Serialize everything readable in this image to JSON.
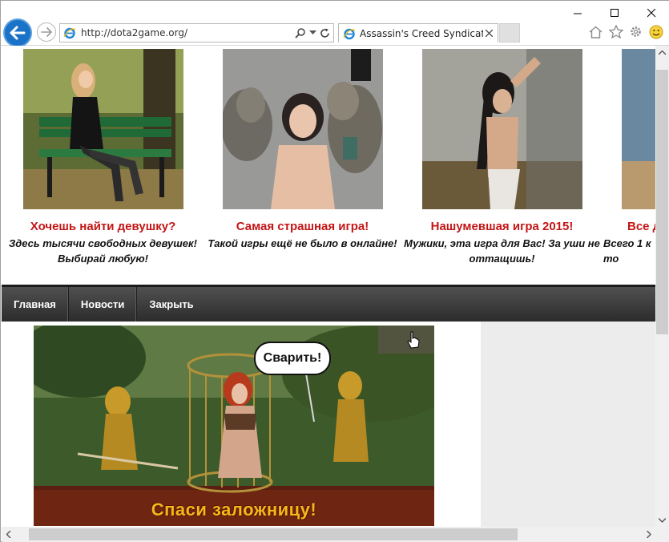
{
  "browser": {
    "url": "http://dota2game.org/",
    "tab_title": "Assassin's Creed Syndicate |...",
    "colors": {
      "back_button": "#1a73c7",
      "accent_red": "#c41616"
    },
    "icons": [
      "back-arrow-icon",
      "forward-arrow-icon",
      "ie-logo-icon",
      "search-icon",
      "dropdown-icon",
      "refresh-icon",
      "close-icon",
      "home-icon",
      "favorites-star-icon",
      "gear-icon",
      "smiley-feedback-icon",
      "minimize-icon",
      "maximize-icon",
      "window-close-icon"
    ]
  },
  "ads": [
    {
      "headline": "Хочешь найти девушку?",
      "text": "Здесь тысячи свободных девушек! Выбирай любую!"
    },
    {
      "headline": "Самая страшная игра!",
      "text": "Такой игры ещё не было в онлайне!"
    },
    {
      "headline": "Нашумевшая игра 2015!",
      "text": "Мужики, эта игра для Вас! За уши не оттащишь!"
    },
    {
      "headline": "Все д",
      "text": "Всего 1 к\nто"
    }
  ],
  "nav": {
    "items": [
      {
        "label": "Главная"
      },
      {
        "label": "Новости"
      },
      {
        "label": "Закрыть"
      }
    ]
  },
  "banner": {
    "speech": "Сварить!",
    "caption": "Спаси заложницу!"
  }
}
